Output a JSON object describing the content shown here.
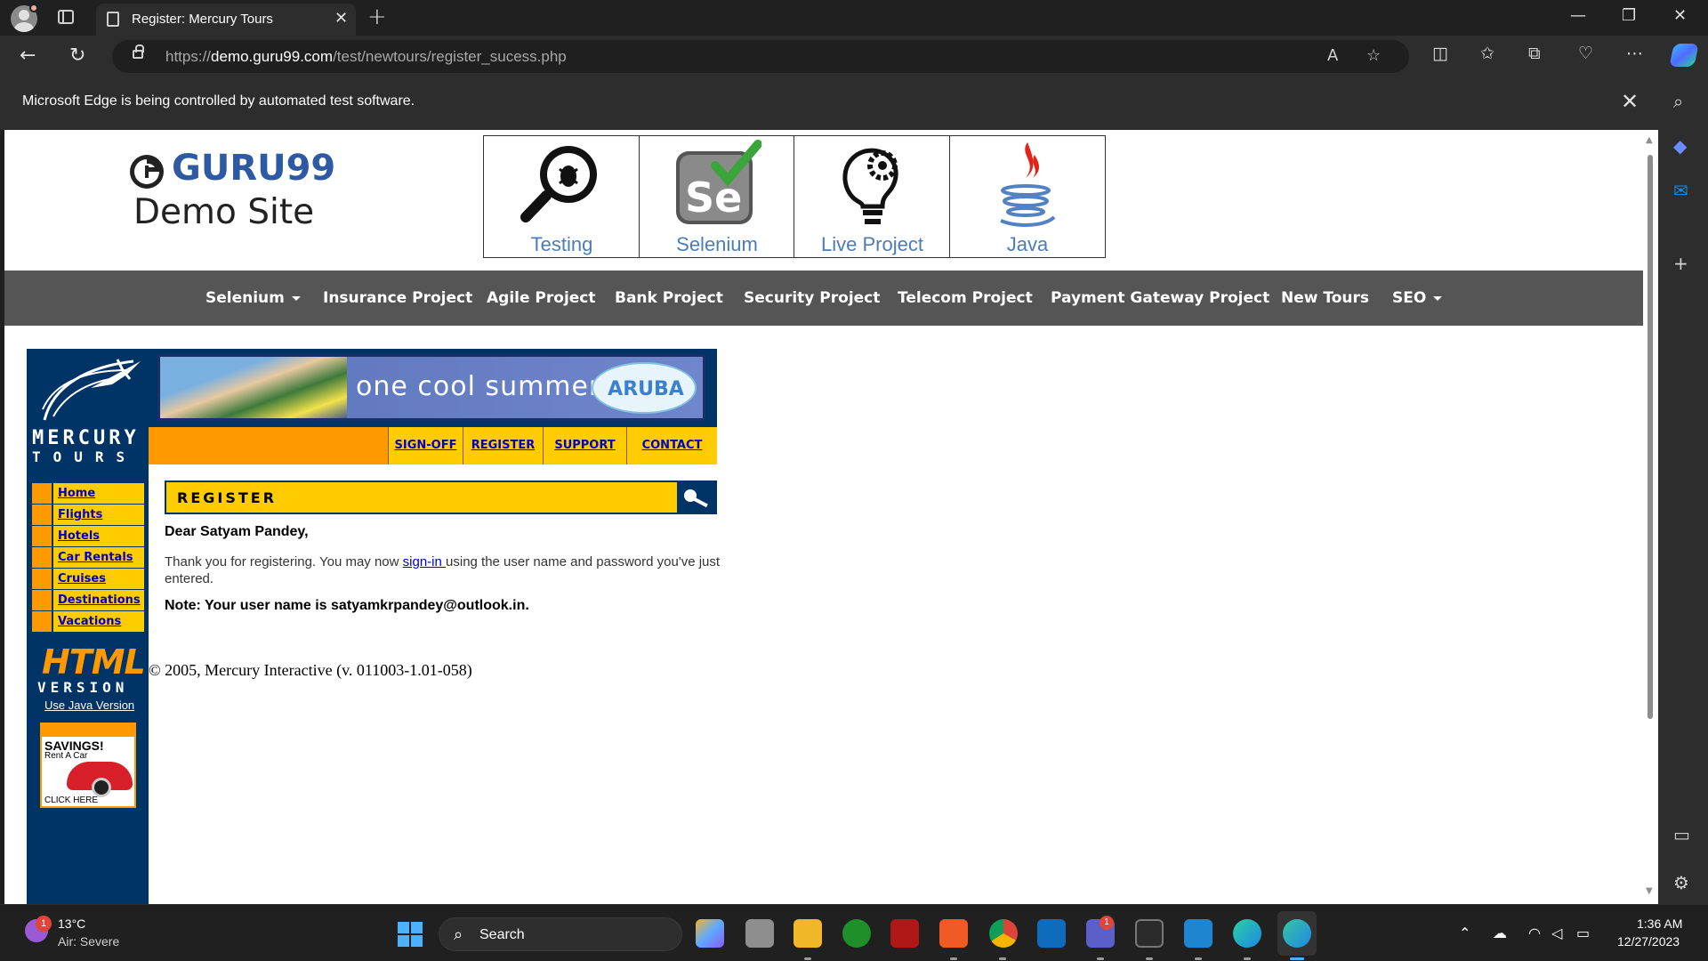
{
  "browser": {
    "tab_title": "Register: Mercury Tours",
    "url_prefix": "https://",
    "url_domain": "demo.guru99.com",
    "url_path": "/test/newtours/register_sucess.php",
    "automation_notice": "Microsoft Edge is being controlled by automated test software."
  },
  "guru99": {
    "brand": "GURU99",
    "subtitle": "Demo Site",
    "tiles": [
      "Testing",
      "Selenium",
      "Live Project",
      "Java"
    ],
    "menu": [
      "Selenium",
      "Insurance Project",
      "Agile Project",
      "Bank Project",
      "Security Project",
      "Telecom Project",
      "Payment Gateway Project",
      "New Tours",
      "SEO"
    ]
  },
  "mercury": {
    "logo_word1": "MERCURY",
    "logo_word2": "TOURS",
    "banner_text": "one cool summer",
    "banner_logo": "ARUBA",
    "top_nav": [
      "SIGN-OFF",
      "REGISTER",
      "SUPPORT",
      "CONTACT"
    ],
    "side_nav": [
      "Home",
      "Flights",
      "Hotels",
      "Car Rentals",
      "Cruises",
      "Destinations",
      "Vacations"
    ],
    "html_badge": "HTML",
    "version_label": "VERSION",
    "java_link": "Use Java Version",
    "ad_title": "SAVINGS!",
    "ad_sub": "Rent A Car",
    "ad_click": "CLICK HERE",
    "section_title": "REGISTER",
    "greeting": "Dear Satyam Pandey,",
    "thanks_before": "Thank you for registering. You may now ",
    "thanks_link": "sign-in ",
    "thanks_after": "using the user name and password you've just entered.",
    "note": "Note: Your user name is satyamkrpandey@outlook.in.",
    "copyright": "© 2005, Mercury Interactive (v. 011003-1.01-058)"
  },
  "taskbar": {
    "temperature": "13°C",
    "weather_desc": "Air: Severe",
    "weather_badge": "1",
    "search_label": "Search",
    "teams_badge": "1",
    "time": "1:36 AM",
    "date": "12/27/2023"
  },
  "colors": {
    "mercury_navy": "#003366",
    "mercury_orange": "#ff9900",
    "mercury_yellow": "#ffcc00",
    "guru_blue": "#2d5aa3",
    "menu_gray": "#555555",
    "link_blue": "#0000cc"
  }
}
